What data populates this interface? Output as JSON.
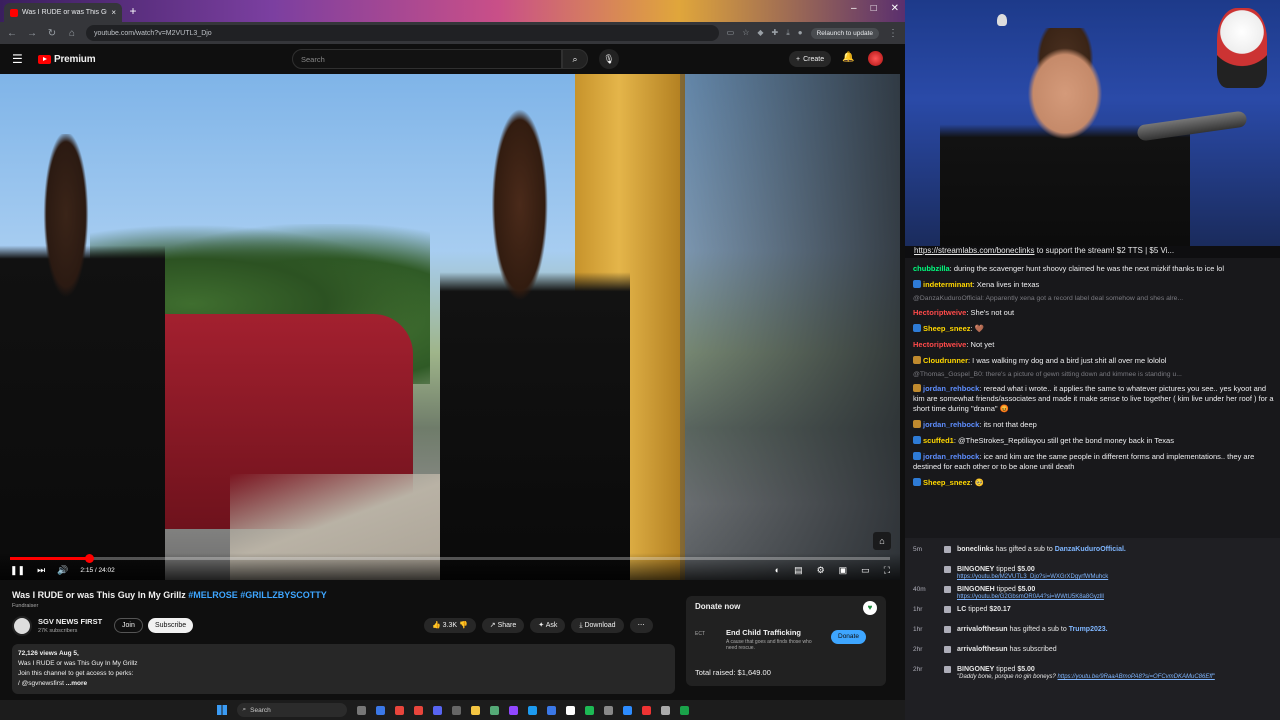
{
  "browser": {
    "tab_title": "Was I RUDE or was This Gu",
    "url": "youtube.com/watch?v=M2VUTL3_Djo",
    "relaunch": "Relaunch to update"
  },
  "yt": {
    "brand": "Premium",
    "search_placeholder": "Search",
    "create_label": "Create"
  },
  "player": {
    "time": "2:15 / 24:02",
    "progress": 0.09
  },
  "video": {
    "title": "Was I RUDE or was This Guy In My Grillz",
    "tags": "#MELROSE #GRILLZBYSCOTTY",
    "fundraiser": "Fundraiser",
    "channel_name": "SGV NEWS FIRST",
    "subscribers": "27K subscribers",
    "join": "Join",
    "subscribe": "Subscribe",
    "likes": "3.3K",
    "share": "Share",
    "ask": "Ask",
    "download": "Download",
    "desc_views": "72,126 views  Aug 5,",
    "desc_line1": "Was I RUDE or was This Guy In My Grillz",
    "desc_line2": "Join this channel to get access to perks:",
    "desc_line3": "/ @sgvnewsfirst",
    "desc_more": "...more"
  },
  "donate": {
    "heading": "Donate now",
    "org": "End Child Trafficking",
    "org_desc": "A cause that goes and finds those who need rescue.",
    "button": "Donate",
    "raised": "Total raised: $1,649.00"
  },
  "taskbar": {
    "search": "Search"
  },
  "chat": {
    "top_link": "https://streamlabs.com/boneclinks",
    "top_rest": " to support the stream! $2 TTS | $5 Vi...",
    "messages": [
      {
        "name": "chubbzilla",
        "color": "#00ff7f",
        "text": "during the scavenger hunt shoovy claimed he was the next mizkif thanks to ice lol",
        "badge": ""
      },
      {
        "name": "indeterminant",
        "color": "#ffd700",
        "text": "Xena lives in texas",
        "badge": "#2e7bd6"
      },
      {
        "name": "",
        "color": "",
        "text": "@DanzaKuduroOfficial: Apparently xena got a record label deal somehow and shes alre...",
        "badge": "",
        "dim": true
      },
      {
        "name": "Hectoriptweive",
        "color": "#ff4a4a",
        "text": "She's not out",
        "badge": ""
      },
      {
        "name": "Sheep_sneez",
        "color": "#ffd700",
        "text": "🤎",
        "badge": "#2e7bd6"
      },
      {
        "name": "Hectoriptweive",
        "color": "#ff4a4a",
        "text": "Not yet",
        "badge": ""
      },
      {
        "name": "Cloudrunner",
        "color": "#ffd700",
        "text": "I was walking my dog and a bird just shit all over me lololol",
        "badge": "#c08a2e"
      },
      {
        "name": "",
        "color": "",
        "text": "@Thomas_Gospel_B0: there's a picture of gewn sitting down and kimmee is standing u...",
        "badge": "",
        "dim": true
      },
      {
        "name": "jordan_rehbock",
        "color": "#5e8eff",
        "text": "reread what i wrote.. it applies the same to whatever pictures you see.. yes kyoot and kim are somewhat friends/associates and made it make sense to live together ( kim live under her roof ) for a short time during \"drama\" 😡",
        "badge": "#c08a2e"
      },
      {
        "name": "jordan_rehbock",
        "color": "#5e8eff",
        "text": "its not that deep",
        "badge": "#c08a2e"
      },
      {
        "name": "scuffed1",
        "color": "#ffd700",
        "text": "@TheStrokes_Reptiliayou still get the bond money back in Texas",
        "badge": "#2e7bd6"
      },
      {
        "name": "jordan_rehbock",
        "color": "#5e8eff",
        "text": "ice and kim are the same people in different forms and implementations.. they are destined for each other or to be alone until death",
        "badge": "#2e7bd6"
      },
      {
        "name": "Sheep_sneez",
        "color": "#ffd700",
        "text": "🥺",
        "badge": "#2e7bd6"
      }
    ]
  },
  "events": [
    {
      "ago": "5m",
      "name": "boneclinks",
      "text": " has gifted a sub to ",
      "target": "DanzaKuduroOfficial.",
      "sub": ""
    },
    {
      "ago": "",
      "name": "BINGONEY",
      "text": " tipped ",
      "amount": "$5.00",
      "link": "https://youtu.be/M2VUTL3_Djo?si=WXGrXDgyrfWMuhck"
    },
    {
      "ago": "40m",
      "name": "BINGONEH",
      "text": " tipped ",
      "amount": "$5.00",
      "link": "https://youtu.be/G2GbsmOR0A4?si=WWtU5K8a8Gyzlll"
    },
    {
      "ago": "1hr",
      "name": "LC",
      "text": " tipped ",
      "amount": "$20.17"
    },
    {
      "ago": "1hr",
      "name": "arrivalofthesun",
      "text": " has gifted a sub to ",
      "target": "Trump2023."
    },
    {
      "ago": "2hr",
      "name": "arrivalofthesun",
      "text": " has subscribed"
    },
    {
      "ago": "2hr",
      "name": "BINGONEY",
      "text": " tipped ",
      "amount": "$5.00",
      "quote": "\"Daddy bone, porque no gin boneys? ",
      "link": "https://youtu.be/9RaaABmoPA8?si=OFCvmDKAMuC86Eff\""
    }
  ]
}
